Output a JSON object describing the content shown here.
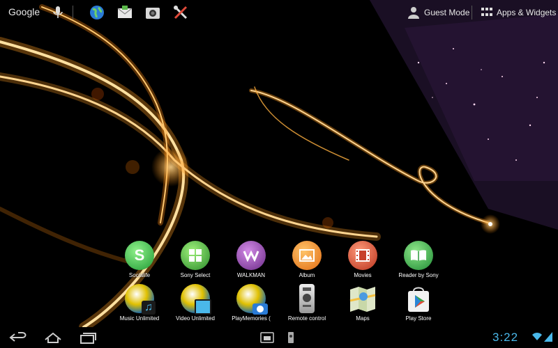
{
  "search": {
    "brand": "Google"
  },
  "quick_icons": [
    "globe-icon",
    "email-icon",
    "camera-icon",
    "settings-tools-icon"
  ],
  "header": {
    "guest_mode_label": "Guest Mode",
    "apps_widgets_label": "Apps & Widgets"
  },
  "apps_row1": [
    {
      "label": "Socialife",
      "icon": "socialife-icon",
      "color": "#2fb64a"
    },
    {
      "label": "Sony Select",
      "icon": "sony-select-icon",
      "color": "#4cb84a"
    },
    {
      "label": "WALKMAN",
      "icon": "walkman-icon",
      "color": "#8a3fa0"
    },
    {
      "label": "Album",
      "icon": "album-icon",
      "color": "#f08a1c"
    },
    {
      "label": "Movies",
      "icon": "movies-icon",
      "color": "#d84a2c"
    },
    {
      "label": "Reader by Sony",
      "icon": "reader-icon",
      "color": "#3aa54a"
    }
  ],
  "apps_row2": [
    {
      "label": "Music Unlimited",
      "icon": "music-unlimited-icon"
    },
    {
      "label": "Video Unlimited",
      "icon": "video-unlimited-icon"
    },
    {
      "label": "PlayMemories (",
      "icon": "playmemories-icon"
    },
    {
      "label": "Remote control",
      "icon": "remote-control-icon"
    },
    {
      "label": "Maps",
      "icon": "maps-icon"
    },
    {
      "label": "Play Store",
      "icon": "play-store-icon"
    }
  ],
  "status": {
    "time": "3:22"
  },
  "colors": {
    "clock": "#4ab8ea",
    "glow": "#ffb040"
  }
}
